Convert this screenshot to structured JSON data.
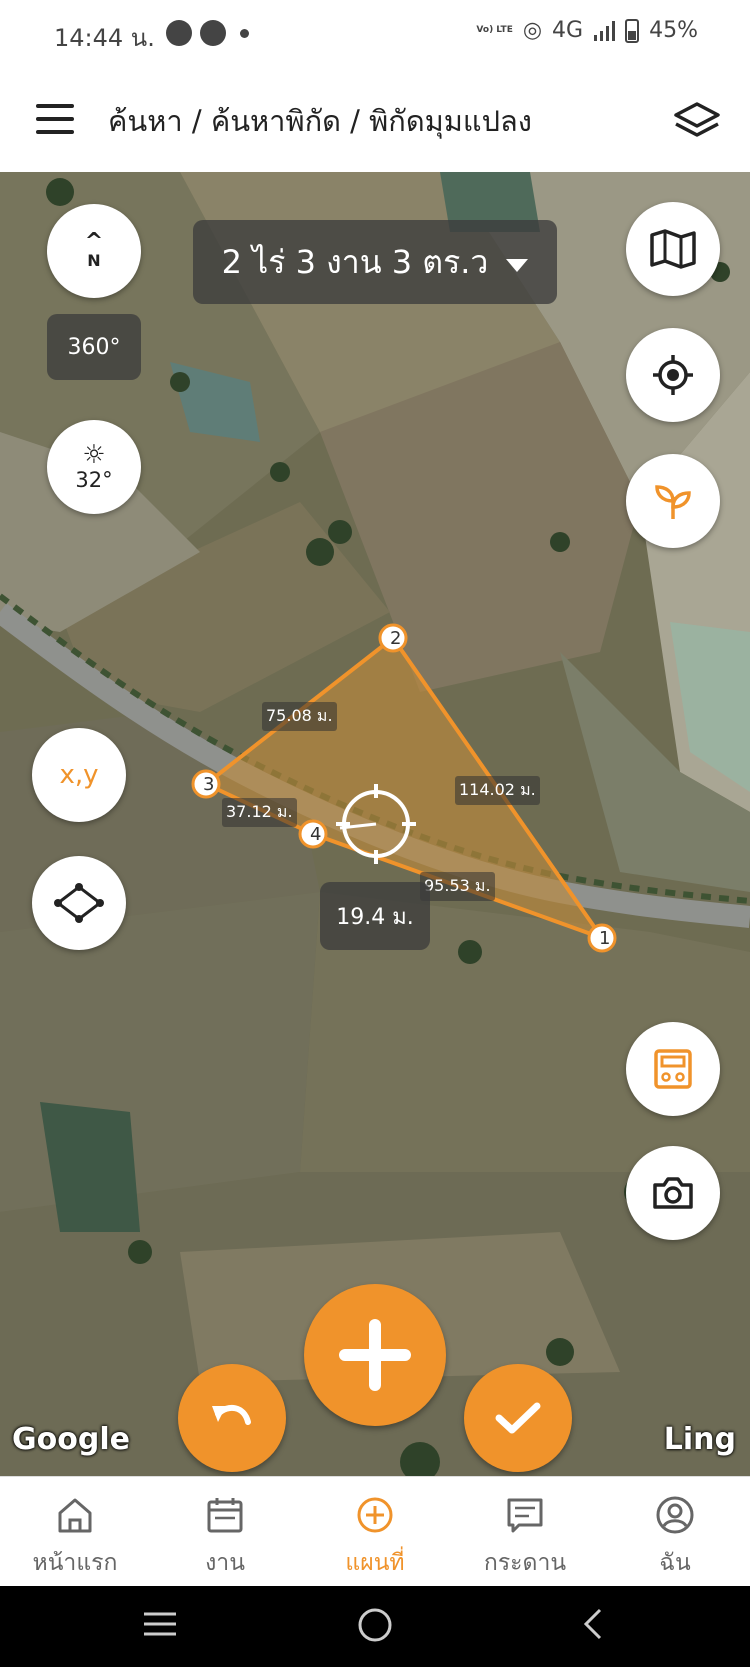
{
  "status_bar": {
    "time": "14:44 น.",
    "network": "4G",
    "lte": "Vo) LTE",
    "battery": "45%"
  },
  "header": {
    "breadcrumb": "ค้นหา / ค้นหาพิกัด / พิกัดมุมแปลง"
  },
  "map": {
    "area_label": "2 ไร่ 3 งาน 3 ตร.ว",
    "compass_letter": "N",
    "heading": "360°",
    "temperature": "32°",
    "xy_label": "x,y",
    "current_distance": "19.4 ม.",
    "points": [
      "1",
      "2",
      "3",
      "4"
    ],
    "segments": {
      "p3_p2": "75.08 ม.",
      "p2_p1": "114.02 ม.",
      "p4_p1": "95.53 ม.",
      "p3_p4": "37.12 ม."
    },
    "attribution_left": "Google",
    "attribution_right": "Ling"
  },
  "bottom_nav": [
    {
      "label": "หน้าแรก",
      "icon": "home-icon"
    },
    {
      "label": "งาน",
      "icon": "calendar-icon"
    },
    {
      "label": "แผนที่",
      "icon": "add-circle-icon"
    },
    {
      "label": "กระดาน",
      "icon": "board-icon"
    },
    {
      "label": "ฉัน",
      "icon": "user-icon"
    }
  ],
  "colors": {
    "accent": "#f0932b",
    "polygon_fill": "#c08a3c",
    "chip_bg": "#3c3c3c"
  }
}
